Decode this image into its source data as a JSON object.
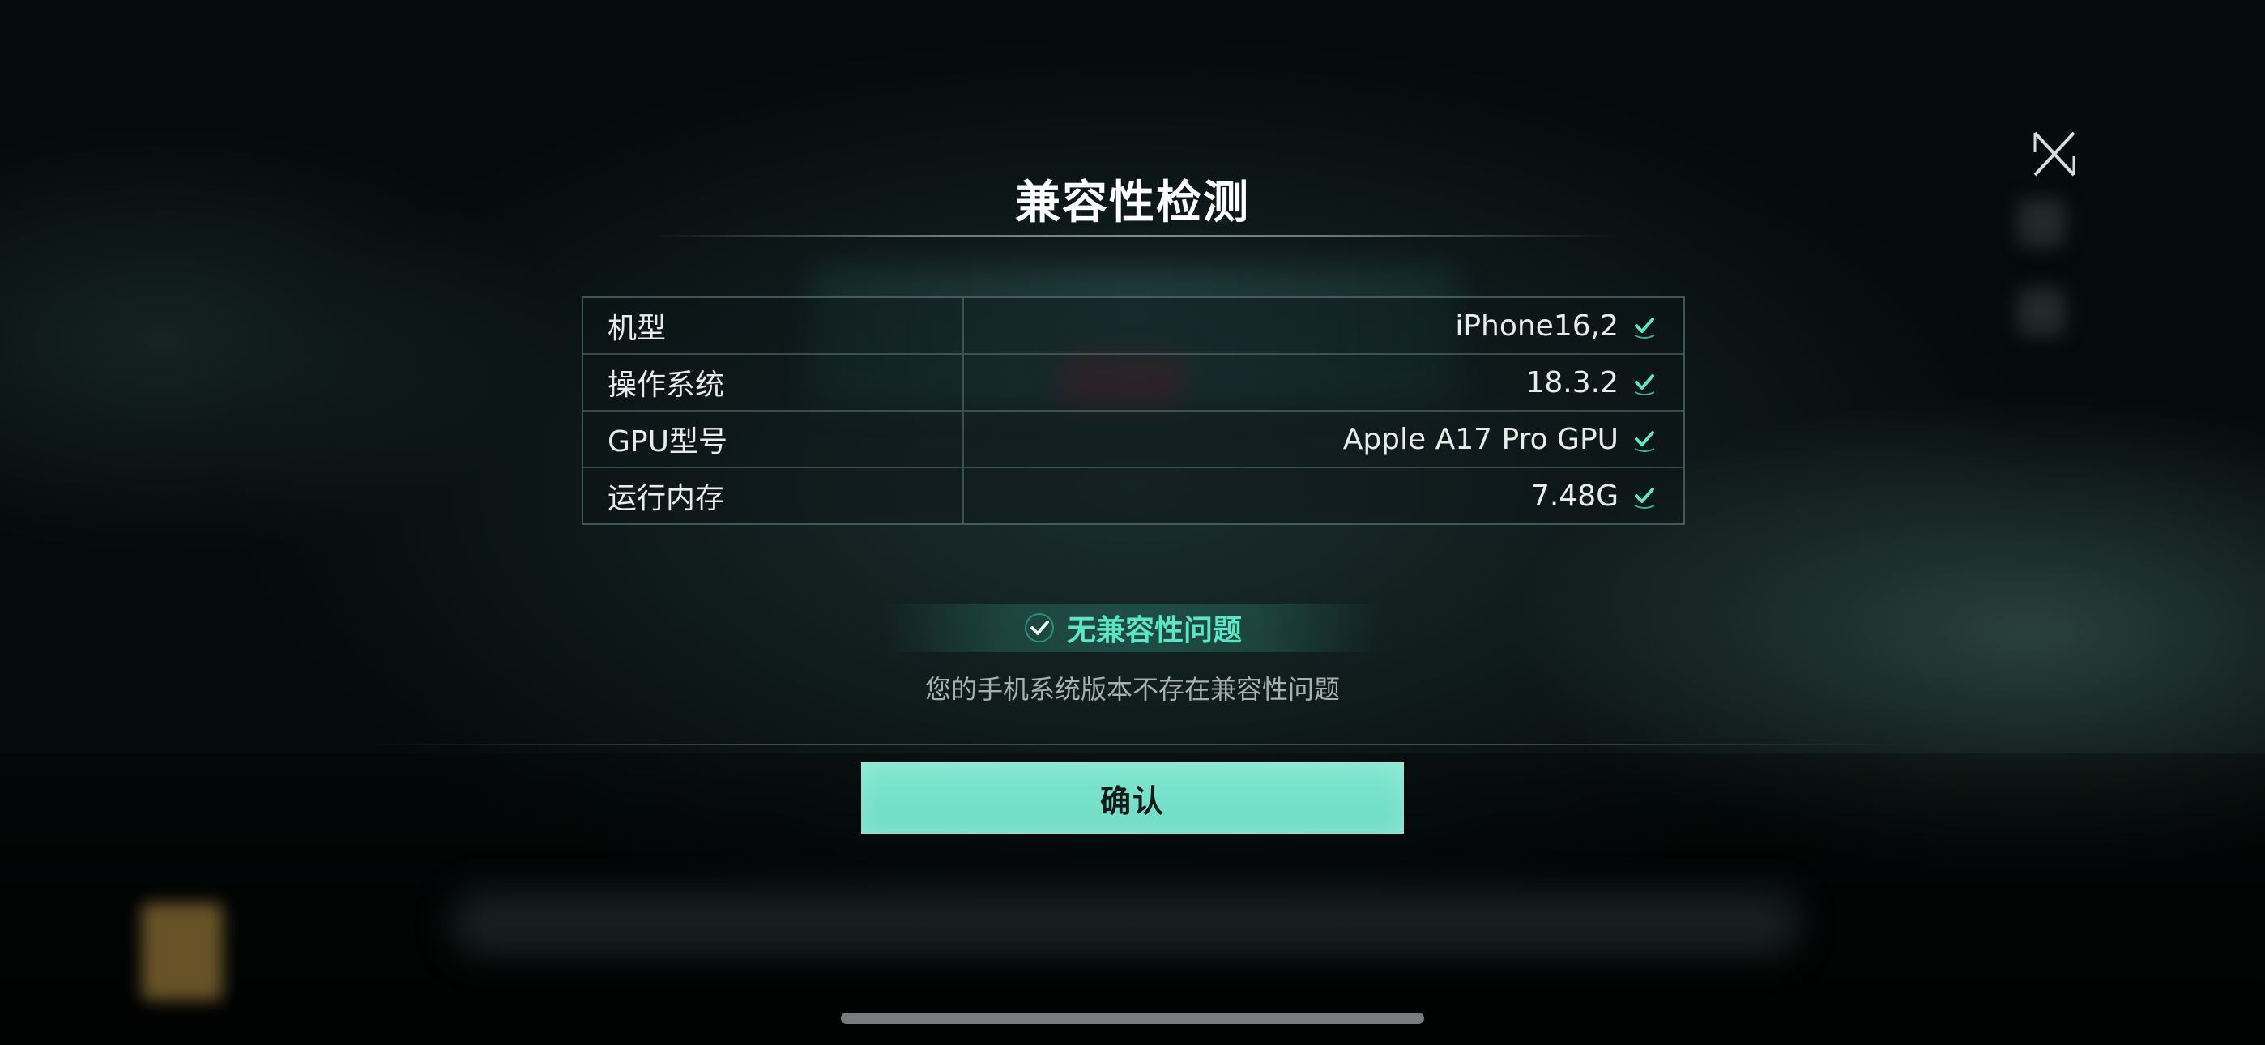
{
  "dialog": {
    "title": "兼容性检测",
    "specs": [
      {
        "label": "机型",
        "value": "iPhone16,2",
        "status_icon": "check-icon"
      },
      {
        "label": "操作系统",
        "value": "18.3.2",
        "status_icon": "check-icon"
      },
      {
        "label": "GPU型号",
        "value": "Apple A17 Pro GPU",
        "status_icon": "check-icon"
      },
      {
        "label": "运行内存",
        "value": "7.48G",
        "status_icon": "check-icon"
      }
    ],
    "status": {
      "icon": "check-icon",
      "label": "无兼容性问题",
      "description": "您的手机系统版本不存在兼容性问题"
    },
    "confirm_label": "确认",
    "close_icon": "close-icon"
  },
  "colors": {
    "accent": "#5be6c4",
    "button": "#74e0c8",
    "text": "#e8ecea",
    "muted": "#a6b0ae"
  }
}
